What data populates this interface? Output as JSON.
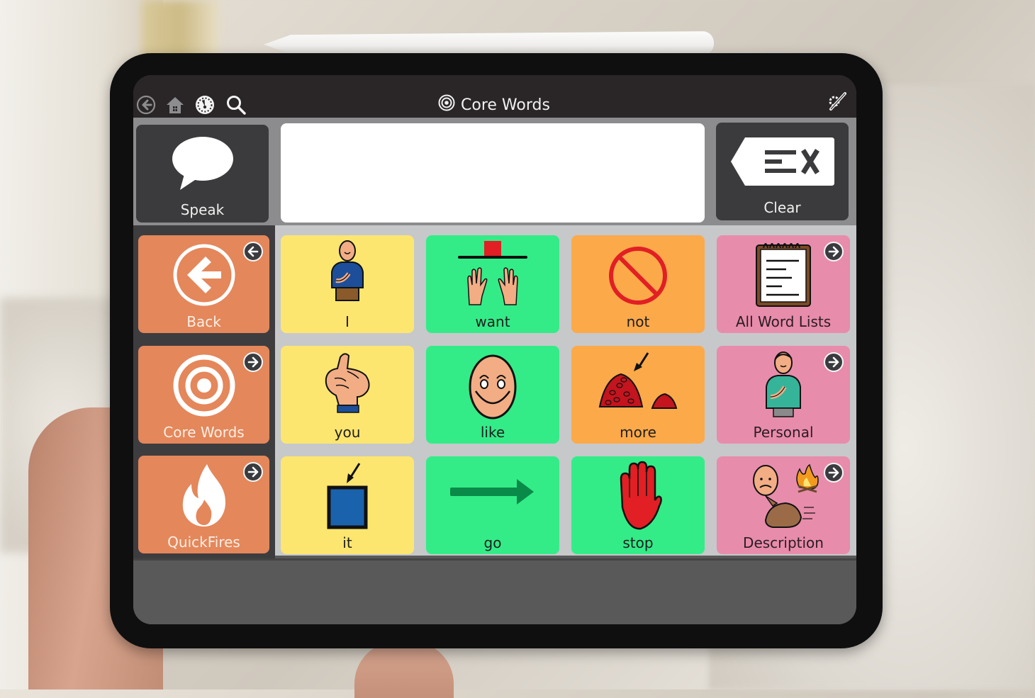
{
  "app": {
    "title": "Core Words",
    "title_icon": "target-icon"
  },
  "toolbar": {
    "left_icons": [
      "back-circle-icon",
      "home-icon",
      "dashboard-gauge-icon",
      "search-icon"
    ],
    "right_icon": "edit-settings-icon"
  },
  "message_bar": {
    "speak_label": "Speak",
    "speak_icon": "speech-bubble-icon",
    "message_text": "",
    "clear_label": "Clear",
    "clear_icon": "clear-text-icon"
  },
  "navigation": [
    {
      "label": "Back",
      "icon": "back-arrow-icon",
      "badge": "arrow-left-icon"
    },
    {
      "label": "Core Words",
      "icon": "target-icon",
      "badge": "arrow-right-icon"
    },
    {
      "label": "QuickFires",
      "icon": "flame-icon",
      "badge": "arrow-right-icon"
    }
  ],
  "grid": {
    "rows": [
      [
        {
          "label": "I",
          "color": "yellow",
          "symbol": "person-pointing-self"
        },
        {
          "label": "want",
          "color": "green",
          "symbol": "hands-reaching"
        },
        {
          "label": "not",
          "color": "orange",
          "symbol": "prohibition"
        },
        {
          "label": "All Word Lists",
          "color": "pink",
          "symbol": "notepad",
          "folder": true
        }
      ],
      [
        {
          "label": "you",
          "color": "yellow",
          "symbol": "pointing-hand"
        },
        {
          "label": "like",
          "color": "green",
          "symbol": "smiling-face"
        },
        {
          "label": "more",
          "color": "orange",
          "symbol": "pile-of-beans"
        },
        {
          "label": "Personal",
          "color": "pink",
          "symbol": "person-self",
          "folder": true
        }
      ],
      [
        {
          "label": "it",
          "color": "yellow",
          "symbol": "box-with-arrow"
        },
        {
          "label": "go",
          "color": "green",
          "symbol": "right-arrow"
        },
        {
          "label": "stop",
          "color": "green",
          "symbol": "red-hand"
        },
        {
          "label": "Description",
          "color": "pink",
          "symbol": "sad-face-fire-rabbit",
          "folder": true
        }
      ]
    ]
  },
  "colors": {
    "toolbar": "#2a2628",
    "nav_orange": "#e4875b",
    "yellow": "#fde66f",
    "green": "#33ec88",
    "orange": "#fca94a",
    "pink": "#e88cab"
  }
}
